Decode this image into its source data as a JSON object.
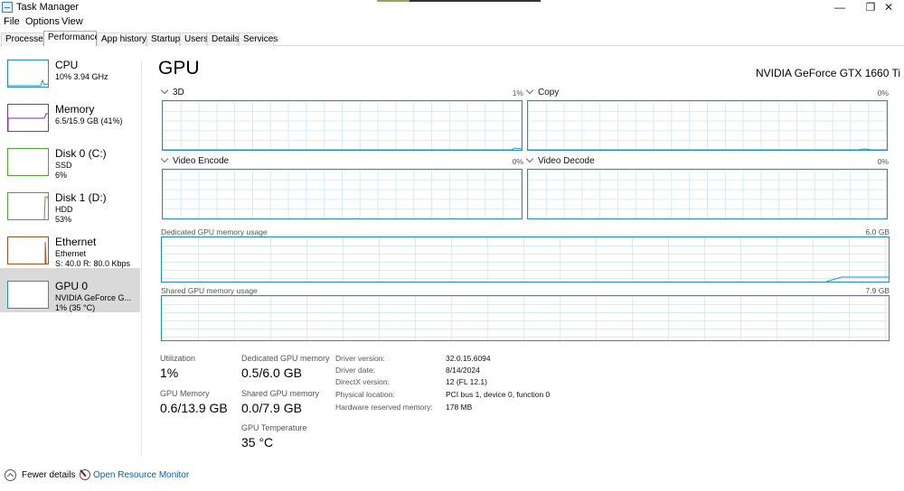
{
  "window": {
    "title": "Task Manager",
    "minimize_glyph": "—",
    "maximize_glyph": "❐",
    "close_glyph": "✕"
  },
  "menu": [
    "File",
    "Options",
    "View"
  ],
  "tabs": [
    "Processes",
    "Performance",
    "App history",
    "Startup",
    "Users",
    "Details",
    "Services"
  ],
  "active_tab": "Performance",
  "sidebar": [
    {
      "title": "CPU",
      "line1": "10% 3.94 GHz",
      "line2": "",
      "color": "#1e8fc9"
    },
    {
      "title": "Memory",
      "line1": "6.5/15.9 GB (41%)",
      "line2": "",
      "color": "#8b2fa3"
    },
    {
      "title": "Disk 0 (C:)",
      "line1": "SSD",
      "line2": "6%",
      "color": "#4aa82c"
    },
    {
      "title": "Disk 1 (D:)",
      "line1": "HDD",
      "line2": "53%",
      "color": "#4aa82c"
    },
    {
      "title": "Ethernet",
      "line1": "Ethernet",
      "line2": "S: 40.0  R: 80.0 Kbps",
      "color": "#a7511c"
    },
    {
      "title": "GPU 0",
      "line1": "NVIDIA GeForce G...",
      "line2": "1% (35 °C)",
      "color": "#1e8fc9"
    }
  ],
  "selected_sidebar": "GPU 0",
  "main": {
    "title": "GPU",
    "gpu_name": "NVIDIA GeForce GTX 1660 Ti",
    "engines": [
      {
        "name": "3D",
        "percent": "1%"
      },
      {
        "name": "Copy",
        "percent": "0%"
      },
      {
        "name": "Video Encode",
        "percent": "0%"
      },
      {
        "name": "Video Decode",
        "percent": "0%"
      }
    ],
    "dedicated": {
      "label": "Dedicated GPU memory usage",
      "max": "6.0 GB"
    },
    "shared": {
      "label": "Shared GPU memory usage",
      "max": "7.9 GB"
    }
  },
  "stats": {
    "utilization": {
      "label": "Utilization",
      "value": "1%"
    },
    "dedicated_memory": {
      "label": "Dedicated GPU memory",
      "value": "0.5/6.0 GB"
    },
    "gpu_memory": {
      "label": "GPU Memory",
      "value": "0.6/13.9 GB"
    },
    "shared_memory": {
      "label": "Shared GPU memory",
      "value": "0.0/7.9 GB"
    },
    "temperature": {
      "label": "GPU Temperature",
      "value": "35 °C"
    }
  },
  "details": [
    {
      "key": "Driver version:",
      "value": "32.0.15.6094"
    },
    {
      "key": "Driver date:",
      "value": "8/14/2024"
    },
    {
      "key": "DirectX version:",
      "value": "12 (FL 12.1)"
    },
    {
      "key": "Physical location:",
      "value": "PCI bus 1, device 0, function 0"
    },
    {
      "key": "Hardware reserved memory:",
      "value": "178 MB"
    }
  ],
  "footer": {
    "fewer_details": "Fewer details",
    "resource_monitor": "Open Resource Monitor"
  },
  "colors": {
    "gpu_line": "#1e8fc9",
    "grid": "#d6ebf6",
    "selected_bg": "#d9d9d9",
    "link": "#0a5db8"
  }
}
